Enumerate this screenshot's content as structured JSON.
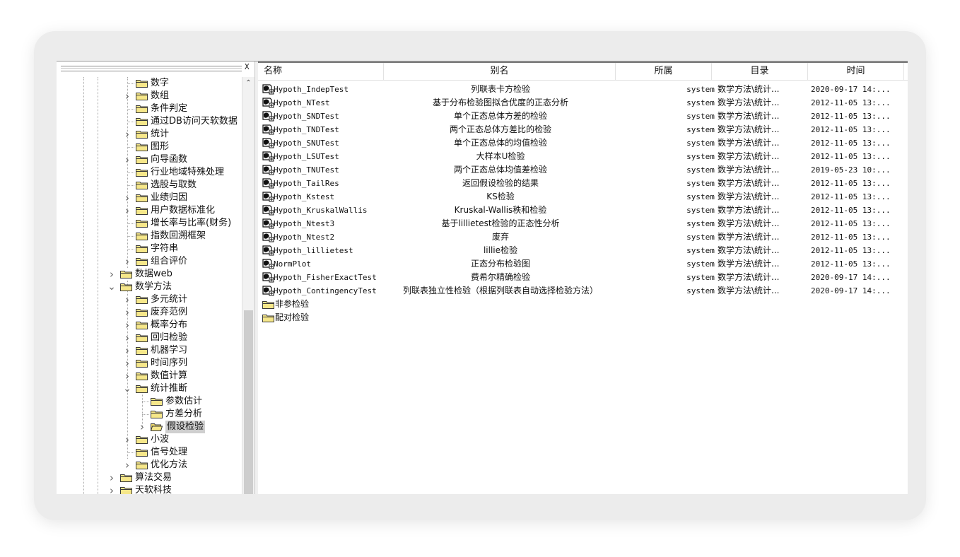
{
  "tree": {
    "close_glyph": "X",
    "scroll_up_glyph": "⌃",
    "items": [
      {
        "label": "数字",
        "level": 2,
        "twisty": ""
      },
      {
        "label": "数组",
        "level": 2,
        "twisty": ">"
      },
      {
        "label": "条件判定",
        "level": 2,
        "twisty": ""
      },
      {
        "label": "通过DB访问天软数据",
        "level": 2,
        "twisty": ""
      },
      {
        "label": "统计",
        "level": 2,
        "twisty": ">"
      },
      {
        "label": "图形",
        "level": 2,
        "twisty": ""
      },
      {
        "label": "向导函数",
        "level": 2,
        "twisty": ">"
      },
      {
        "label": "行业地域特殊处理",
        "level": 2,
        "twisty": ""
      },
      {
        "label": "选股与取数",
        "level": 2,
        "twisty": ""
      },
      {
        "label": "业绩归因",
        "level": 2,
        "twisty": ">"
      },
      {
        "label": "用户数据标准化",
        "level": 2,
        "twisty": ">"
      },
      {
        "label": "增长率与比率(财务)",
        "level": 2,
        "twisty": ""
      },
      {
        "label": "指数回溯框架",
        "level": 2,
        "twisty": ""
      },
      {
        "label": "字符串",
        "level": 2,
        "twisty": ""
      },
      {
        "label": "组合评价",
        "level": 2,
        "twisty": ">"
      },
      {
        "label": "数据web",
        "level": 1,
        "twisty": ">"
      },
      {
        "label": "数学方法",
        "level": 1,
        "twisty": "v"
      },
      {
        "label": "多元统计",
        "level": 2,
        "twisty": ">"
      },
      {
        "label": "废弃范例",
        "level": 2,
        "twisty": ">"
      },
      {
        "label": "概率分布",
        "level": 2,
        "twisty": ">"
      },
      {
        "label": "回归检验",
        "level": 2,
        "twisty": ">"
      },
      {
        "label": "机器学习",
        "level": 2,
        "twisty": ">"
      },
      {
        "label": "时间序列",
        "level": 2,
        "twisty": ">"
      },
      {
        "label": "数值计算",
        "level": 2,
        "twisty": ">"
      },
      {
        "label": "统计推断",
        "level": 2,
        "twisty": "v"
      },
      {
        "label": "参数估计",
        "level": 3,
        "twisty": ""
      },
      {
        "label": "方差分析",
        "level": 3,
        "twisty": ""
      },
      {
        "label": "假设检验",
        "level": 3,
        "twisty": ">",
        "selected": true,
        "open": true
      },
      {
        "label": "小波",
        "level": 2,
        "twisty": ">"
      },
      {
        "label": "信号处理",
        "level": 2,
        "twisty": ""
      },
      {
        "label": "优化方法",
        "level": 2,
        "twisty": ">"
      },
      {
        "label": "算法交易",
        "level": 1,
        "twisty": ">"
      },
      {
        "label": "天软科技",
        "level": 1,
        "twisty": ">"
      }
    ]
  },
  "list": {
    "columns": [
      "名称",
      "别名",
      "所属",
      "目录",
      "时间"
    ],
    "rows": [
      {
        "name": "Hypoth_IndepTest",
        "alias": "列联表卡方检验",
        "owner": "system",
        "dir": "数学方法\\统计...",
        "time": "2020-09-17 14:..."
      },
      {
        "name": "Hypoth_NTest",
        "alias": "基于分布检验图拟合优度的正态分析",
        "owner": "system",
        "dir": "数学方法\\统计...",
        "time": "2012-11-05 13:..."
      },
      {
        "name": "Hypoth_SNDTest",
        "alias": "单个正态总体方差的检验",
        "owner": "system",
        "dir": "数学方法\\统计...",
        "time": "2012-11-05 13:..."
      },
      {
        "name": "Hypoth_TNDTest",
        "alias": "两个正态总体方差比的检验",
        "owner": "system",
        "dir": "数学方法\\统计...",
        "time": "2012-11-05 13:..."
      },
      {
        "name": "Hypoth_SNUTest",
        "alias": "单个正态总体的均值检验",
        "owner": "system",
        "dir": "数学方法\\统计...",
        "time": "2012-11-05 13:..."
      },
      {
        "name": "Hypoth_LSUTest",
        "alias": "大样本U检验",
        "owner": "system",
        "dir": "数学方法\\统计...",
        "time": "2012-11-05 13:..."
      },
      {
        "name": "Hypoth_TNUTest",
        "alias": "两个正态总体均值差检验",
        "owner": "system",
        "dir": "数学方法\\统计...",
        "time": "2019-05-23 10:..."
      },
      {
        "name": "Hypoth_TailRes",
        "alias": "返回假设检验的结果",
        "owner": "system",
        "dir": "数学方法\\统计...",
        "time": "2012-11-05 13:..."
      },
      {
        "name": "Hypoth_Kstest",
        "alias": "KS检验",
        "owner": "system",
        "dir": "数学方法\\统计...",
        "time": "2012-11-05 13:..."
      },
      {
        "name": "Hypoth_KruskalWallis",
        "alias": "Kruskal-Wallis秩和检验",
        "owner": "system",
        "dir": "数学方法\\统计...",
        "time": "2012-11-05 13:..."
      },
      {
        "name": "Hypoth_Ntest3",
        "alias": "基于lillietest检验的正态性分析",
        "owner": "system",
        "dir": "数学方法\\统计...",
        "time": "2012-11-05 13:..."
      },
      {
        "name": "Hypoth_Ntest2",
        "alias": "废弃",
        "owner": "system",
        "dir": "数学方法\\统计...",
        "time": "2012-11-05 13:..."
      },
      {
        "name": "Hypoth_lillietest",
        "alias": "lillie检验",
        "owner": "system",
        "dir": "数学方法\\统计...",
        "time": "2012-11-05 13:..."
      },
      {
        "name": "NormPlot",
        "alias": "正态分布检验图",
        "owner": "system",
        "dir": "数学方法\\统计...",
        "time": "2012-11-05 13:..."
      },
      {
        "name": "Hypoth_FisherExactTest",
        "alias": "费希尔精确检验",
        "owner": "system",
        "dir": "数学方法\\统计...",
        "time": "2020-09-17 14:..."
      },
      {
        "name": "Hypoth_ContingencyTest",
        "alias": "列联表独立性检验（根据列联表自动选择检验方法）",
        "owner": "system",
        "dir": "数学方法\\统计...",
        "time": "2020-09-17 14:..."
      }
    ],
    "folders": [
      "非参检验",
      "配对检验"
    ]
  },
  "colors": {
    "folder_fill": "#f6e78a",
    "folder_stroke": "#3a3a3a",
    "selection": "#cfcfcf"
  }
}
